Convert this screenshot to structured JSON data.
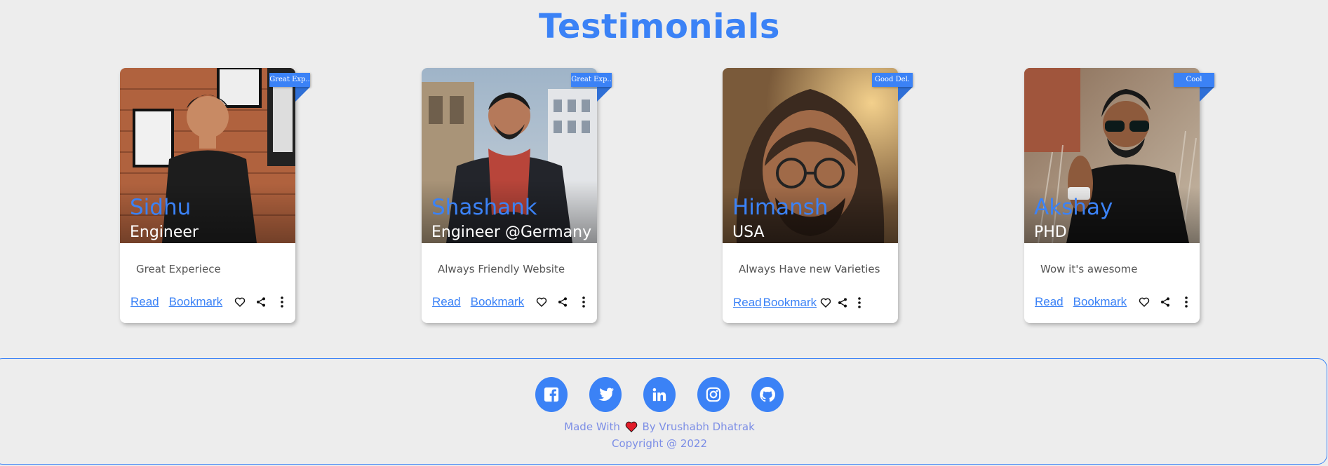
{
  "page": {
    "title": "Testimonials"
  },
  "cards": [
    {
      "name": "Sidhu",
      "role": "Engineer",
      "badge": "Great Exp..",
      "quote": "Great Experiece",
      "read": "Read",
      "bookmark": "Bookmark"
    },
    {
      "name": "Shashank",
      "role": "Engineer @Germany",
      "badge": "Great Exp..",
      "quote": "Always Friendly Website",
      "read": "Read",
      "bookmark": "Bookmark"
    },
    {
      "name": "Himansh",
      "role": "USA",
      "badge": "Good Del.",
      "quote": "Always Have new Varieties",
      "read": "Read",
      "bookmark": "Bookmark"
    },
    {
      "name": "Akshay",
      "role": "PHD",
      "badge": "Cool",
      "quote": "Wow it's awesome",
      "read": "Read",
      "bookmark": "Bookmark"
    }
  ],
  "footer": {
    "social": [
      "facebook-icon",
      "twitter-icon",
      "linkedin-icon",
      "instagram-icon",
      "github-icon"
    ],
    "made_with_prefix": "Made With",
    "made_with_suffix": "By Vrushabh Dhatrak",
    "copyright": "Copyright @ 2022"
  },
  "colors": {
    "accent": "#3b82f6",
    "background": "#ededed",
    "footer_text": "#7c8ee6",
    "heart": "#e11d2a"
  }
}
